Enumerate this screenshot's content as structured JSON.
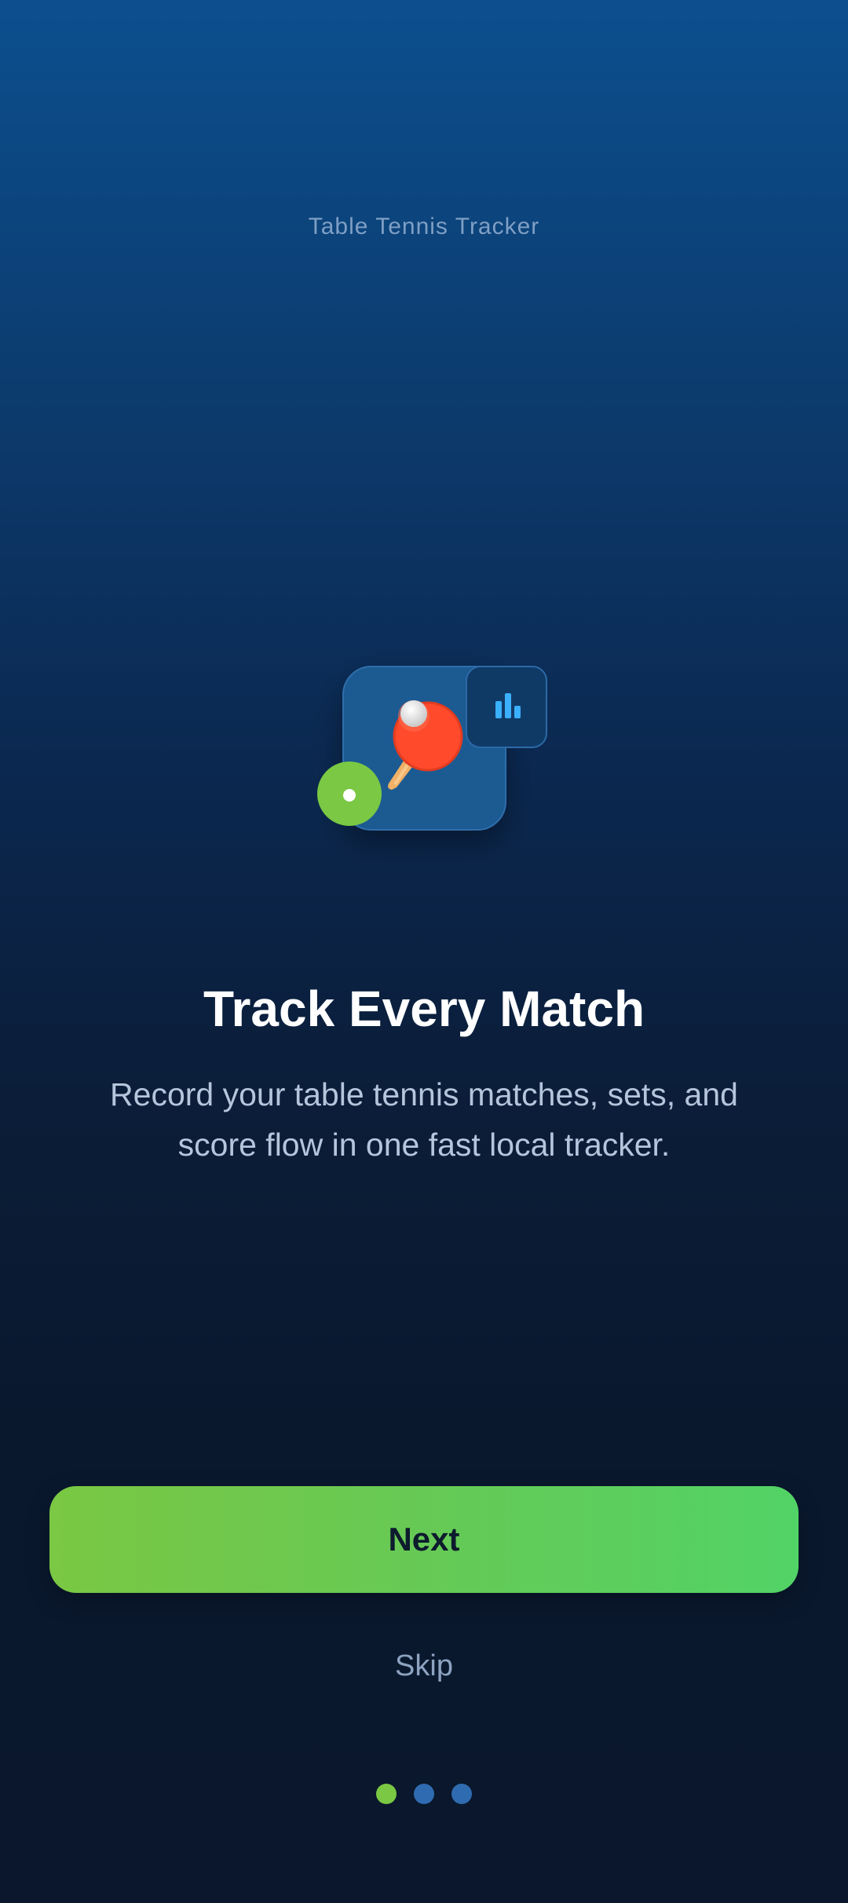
{
  "app": {
    "name": "Table Tennis Tracker"
  },
  "onboarding": {
    "title": "Track Every Match",
    "description": "Record your table tennis matches, sets, and score flow in one fast local tracker.",
    "next_label": "Next",
    "skip_label": "Skip",
    "current_page": 1,
    "total_pages": 3
  },
  "illustration": {
    "icons": [
      "ping-pong-paddle-icon",
      "ping-pong-ball-icon",
      "bar-chart-icon",
      "tennis-ball-icon"
    ]
  },
  "colors": {
    "accent_green": "#7ac843",
    "dot_inactive": "#2f6bb0",
    "card_blue": "#1e5a92",
    "paddle_red": "#ff4a2b"
  }
}
